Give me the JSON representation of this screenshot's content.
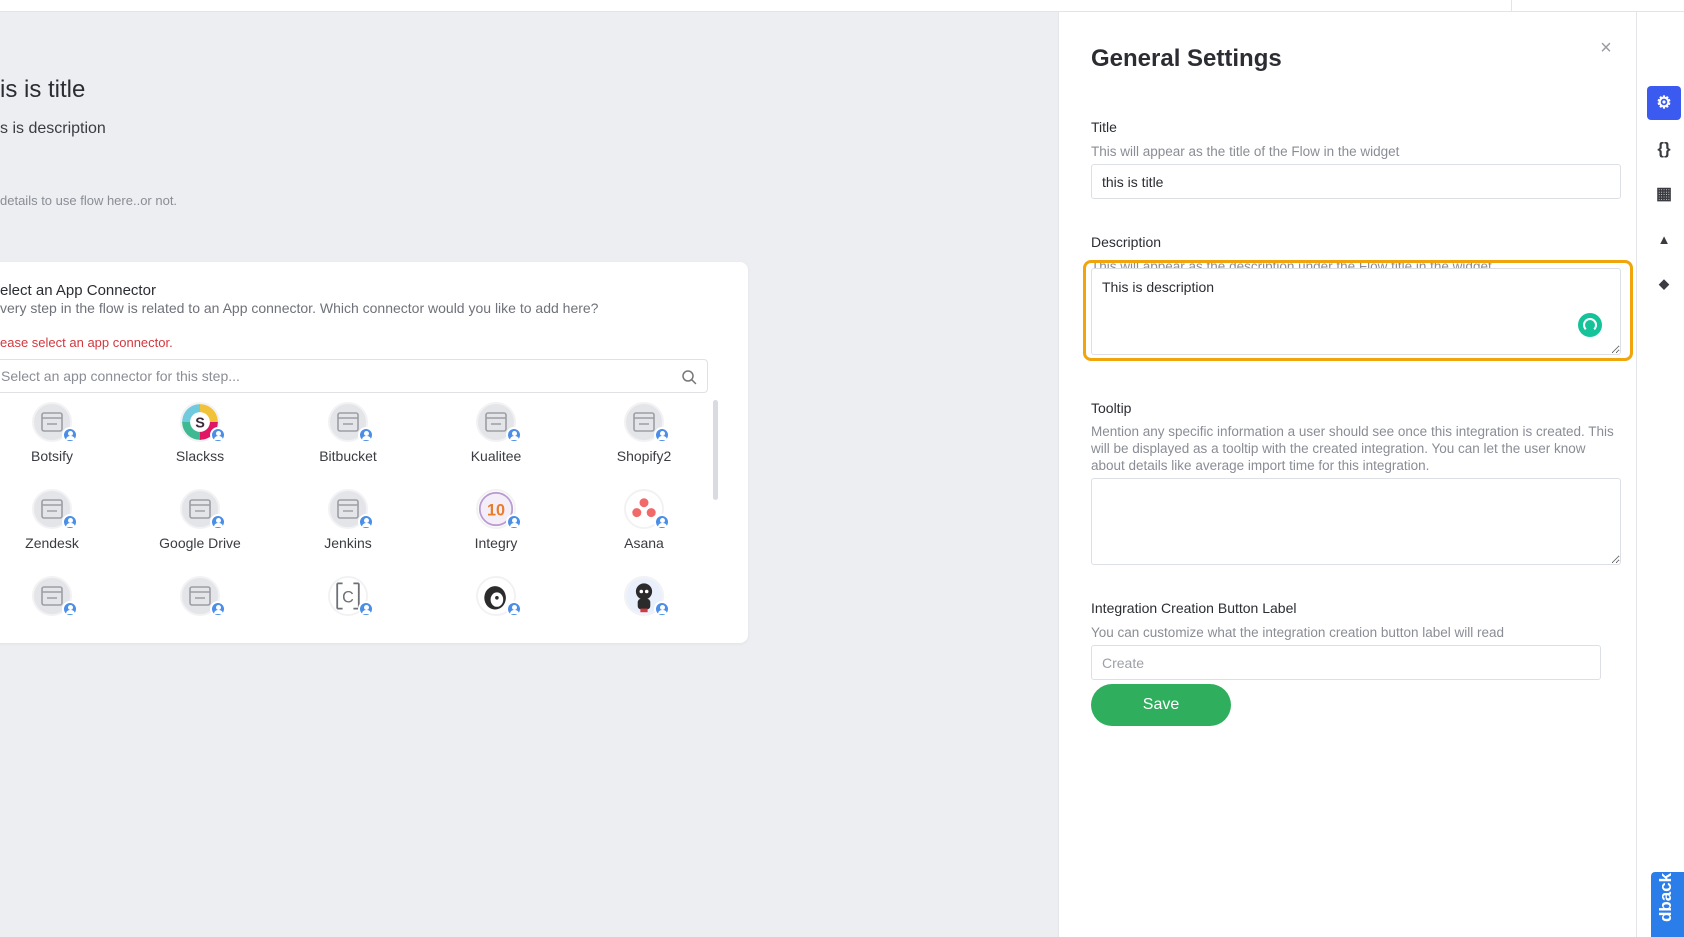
{
  "preview": {
    "title": "is is title",
    "description": "s is description",
    "details": "details to use flow here..or not."
  },
  "connector_card": {
    "heading": "elect an App Connector",
    "subtitle": "very step in the flow is related to an App connector. Which connector would you like to add here?",
    "error": "ease select an app connector.",
    "search_placeholder": "Select an app connector for this step...",
    "apps": [
      {
        "name": "Botsify",
        "icon": "window-icon"
      },
      {
        "name": "Slackss",
        "icon": "slack-logo-icon"
      },
      {
        "name": "Bitbucket",
        "icon": "window-icon"
      },
      {
        "name": "Kualitee",
        "icon": "window-icon"
      },
      {
        "name": "Shopify2",
        "icon": "window-icon"
      },
      {
        "name": "Zendesk",
        "icon": "window-icon"
      },
      {
        "name": "Google Drive",
        "icon": "window-icon"
      },
      {
        "name": "Jenkins",
        "icon": "window-icon"
      },
      {
        "name": "Integry",
        "icon": "integry-logo-icon"
      },
      {
        "name": "Asana",
        "icon": "asana-logo-icon"
      },
      {
        "name": "",
        "icon": "window-icon"
      },
      {
        "name": "",
        "icon": "window-icon"
      },
      {
        "name": "",
        "icon": "c-logo-icon"
      },
      {
        "name": "",
        "icon": "mailchimp-logo-icon"
      },
      {
        "name": "",
        "icon": "github-logo-icon"
      }
    ]
  },
  "settings": {
    "title": "General Settings",
    "close": "×",
    "title_field": {
      "label": "Title",
      "help": "This will appear as the title of the Flow in the widget",
      "value": "this is title"
    },
    "description_field": {
      "label": "Description",
      "help": "This will appear as the description under the Flow title in the widget",
      "value": "This is description"
    },
    "tooltip_field": {
      "label": "Tooltip",
      "help": "Mention any specific information a user should see once this integration is created. This will be displayed as a tooltip with the created integration. You can let the user know about details like average import time for this integration.",
      "value": ""
    },
    "button_label_field": {
      "label": "Integration Creation Button Label",
      "help": "You can customize what the integration creation button label will read",
      "placeholder": "Create",
      "value": ""
    },
    "save_label": "Save"
  },
  "toolbar": {
    "items": [
      {
        "name": "settings",
        "icon": "gear-icon",
        "glyph": "⚙",
        "active": true
      },
      {
        "name": "code",
        "icon": "braces-icon",
        "glyph": "{}",
        "active": false
      },
      {
        "name": "layout",
        "icon": "table-icon",
        "glyph": "▦",
        "active": false
      },
      {
        "name": "warnings",
        "icon": "warning-icon",
        "glyph": "▲",
        "active": false
      },
      {
        "name": "tags",
        "icon": "tag-icon",
        "glyph": "◆",
        "active": false
      }
    ],
    "feedback_label": "dback"
  },
  "colors": {
    "accent": "#3b5bf0",
    "save": "#2faf5e",
    "focus": "#f0a50c",
    "error": "#d2383e",
    "feedback": "#2b7de9"
  }
}
